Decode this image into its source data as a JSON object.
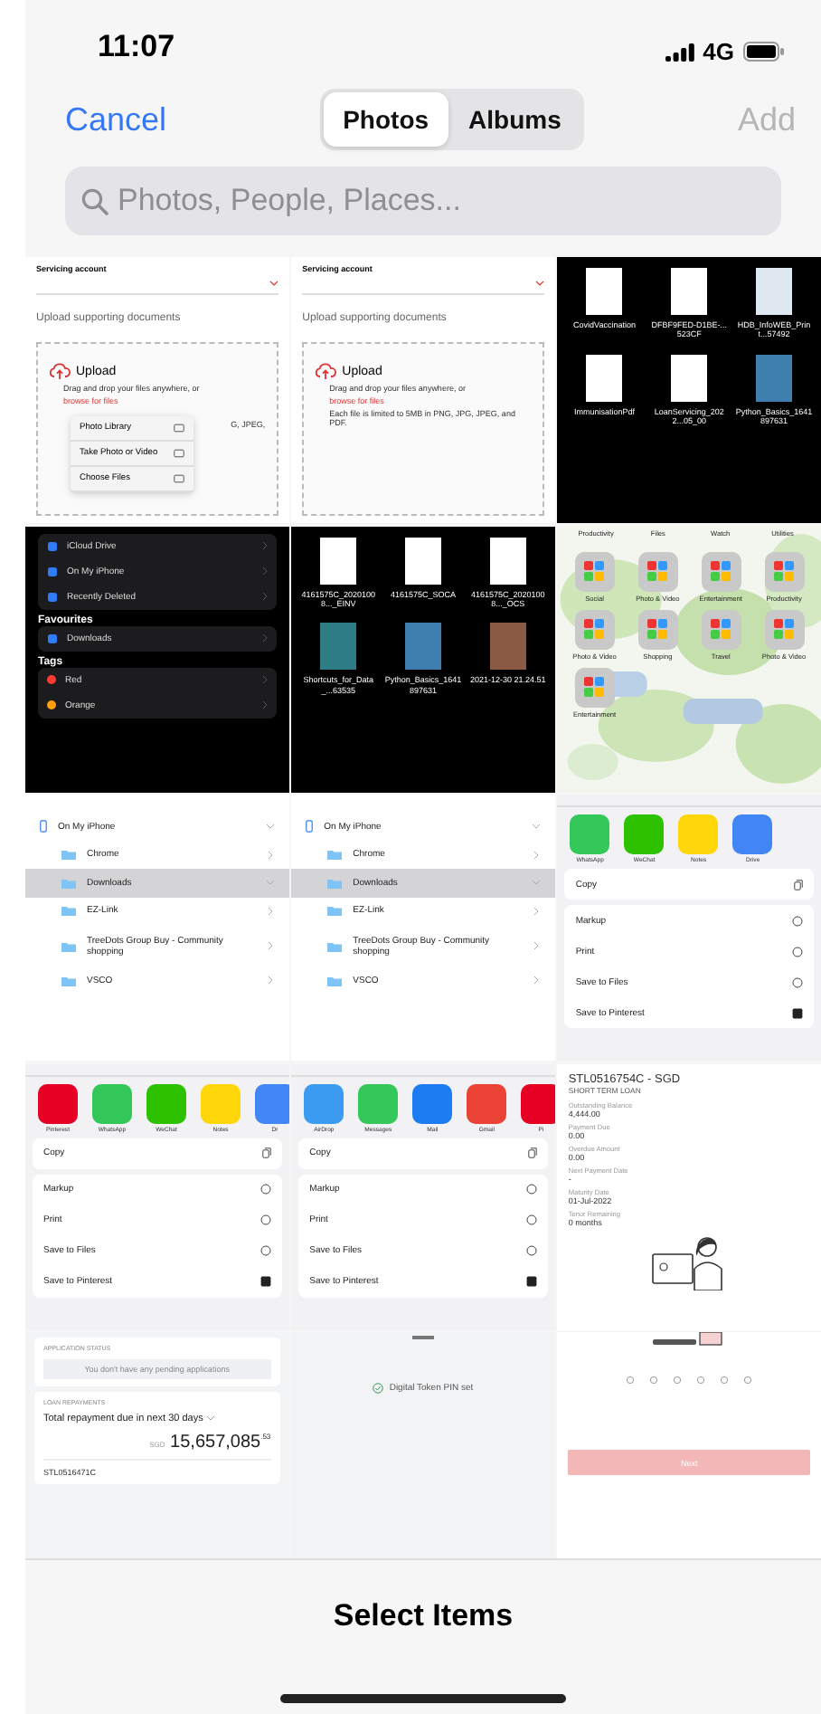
{
  "status_bar": {
    "time": "11:07",
    "network": "4G"
  },
  "nav": {
    "cancel": "Cancel",
    "add": "Add",
    "add_disabled": true,
    "segments": [
      {
        "label": "Photos",
        "selected": true
      },
      {
        "label": "Albums",
        "selected": false
      }
    ]
  },
  "search": {
    "placeholder": "Photos, People, Places..."
  },
  "photos": [
    {
      "kind": "upload_form",
      "field_label": "Servicing account",
      "section": "Upload supporting documents",
      "upload": "Upload",
      "hint": "Drag and drop your files anywhere, or",
      "link": "browse for files",
      "note": "G, JPEG,",
      "menu": [
        "Photo Library",
        "Take Photo or Video",
        "Choose Files"
      ]
    },
    {
      "kind": "upload_form",
      "field_label": "Servicing account",
      "section": "Upload supporting documents",
      "upload": "Upload",
      "hint": "Drag and drop your files anywhere, or",
      "link": "browse for files",
      "note": "Each file is limited to 5MB in PNG, JPG, JPEG, and PDF."
    },
    {
      "kind": "file_grid",
      "files": [
        {
          "name": "CovidVaccination",
          "color": "#ffffff"
        },
        {
          "name": "DFBF9FED-D1BE-...523CF",
          "color": "#ffffff"
        },
        {
          "name": "HDB_InfoWEB_Print...57492",
          "color": "#dfe8f0"
        },
        {
          "name": "ImmunisationPdf",
          "color": "#ffffff"
        },
        {
          "name": "LoanServicing_2022...05_00",
          "color": "#ffffff"
        },
        {
          "name": "Python_Basics_1641897631",
          "color": "#3f7fb0"
        }
      ]
    },
    {
      "kind": "files_sidebar",
      "groups": [
        {
          "items": [
            {
              "label": "iCloud Drive"
            },
            {
              "label": "On My iPhone"
            },
            {
              "label": "Recently Deleted"
            }
          ]
        },
        {
          "title": "Favourites",
          "items": [
            {
              "label": "Downloads"
            }
          ]
        },
        {
          "title": "Tags",
          "items": [
            {
              "label": "Red",
              "color": "#ff3b30"
            },
            {
              "label": "Orange",
              "color": "#ff9f0a"
            }
          ]
        }
      ]
    },
    {
      "kind": "file_grid",
      "files": [
        {
          "name": "4161575C_20201008..._EINV",
          "color": "#ffffff"
        },
        {
          "name": "4161575C_SOCA",
          "color": "#ffffff"
        },
        {
          "name": "4161575C_20201008..._OCS",
          "color": "#ffffff"
        },
        {
          "name": "Shortcuts_for_Data_...63535",
          "color": "#2e7d86"
        },
        {
          "name": "Python_Basics_1641897631",
          "color": "#3f7fb0"
        },
        {
          "name": "2021-12-30 21.24.51",
          "color": "#8a5a44"
        }
      ]
    },
    {
      "kind": "home_screen",
      "top_labels": [
        "Productivity",
        "Files",
        "Watch",
        "Utilities"
      ],
      "folders": [
        {
          "label": "Social"
        },
        {
          "label": "Photo & Video"
        },
        {
          "label": "Entertainment"
        },
        {
          "label": "Productivity"
        },
        {
          "label": "Photo & Video"
        },
        {
          "label": "Shopping"
        },
        {
          "label": "Travel"
        },
        {
          "label": "Photo & Video"
        },
        {
          "label": "Entertainment"
        }
      ]
    },
    {
      "kind": "folder_list",
      "rows": [
        {
          "label": "On My iPhone",
          "selected": false
        },
        {
          "label": "Chrome",
          "selected": false
        },
        {
          "label": "Downloads",
          "selected": true
        },
        {
          "label": "EZ-Link",
          "selected": false
        },
        {
          "label": "TreeDots Group Buy - Community shopping",
          "selected": false
        },
        {
          "label": "VSCO",
          "selected": false
        }
      ]
    },
    {
      "kind": "folder_list",
      "rows": [
        {
          "label": "On My iPhone",
          "selected": false
        },
        {
          "label": "Chrome",
          "selected": false
        },
        {
          "label": "Downloads",
          "selected": true
        },
        {
          "label": "EZ-Link",
          "selected": false
        },
        {
          "label": "TreeDots Group Buy - Community shopping",
          "selected": false
        },
        {
          "label": "VSCO",
          "selected": false
        }
      ]
    },
    {
      "kind": "share_sheet",
      "apps": [
        {
          "label": "WhatsApp",
          "color": "#34c759"
        },
        {
          "label": "WeChat",
          "color": "#2dc100"
        },
        {
          "label": "Notes",
          "color": "#ffd60a"
        },
        {
          "label": "Drive",
          "color": "#4285f4"
        }
      ],
      "actions": [
        "Copy",
        "Markup",
        "Print",
        "Save to Files",
        "Save to Pinterest"
      ]
    },
    {
      "kind": "share_sheet",
      "apps": [
        {
          "label": "Pinterest",
          "color": "#e60023"
        },
        {
          "label": "WhatsApp",
          "color": "#34c759"
        },
        {
          "label": "WeChat",
          "color": "#2dc100"
        },
        {
          "label": "Notes",
          "color": "#ffd60a"
        },
        {
          "label": "Dr",
          "color": "#4285f4"
        }
      ],
      "actions": [
        "Copy",
        "Markup",
        "Print",
        "Save to Files",
        "Save to Pinterest"
      ]
    },
    {
      "kind": "share_sheet",
      "apps": [
        {
          "label": "AirDrop",
          "color": "#3a9bf0"
        },
        {
          "label": "Messages",
          "color": "#34c759"
        },
        {
          "label": "Mail",
          "color": "#1e7cf2"
        },
        {
          "label": "Gmail",
          "color": "#ea4335"
        },
        {
          "label": "Pi",
          "color": "#e60023"
        }
      ],
      "actions": [
        "Copy",
        "Markup",
        "Print",
        "Save to Files",
        "Save to Pinterest"
      ]
    },
    {
      "kind": "loan_detail",
      "title": "STL0516754C - SGD",
      "subtitle": "SHORT TERM LOAN",
      "fields": [
        {
          "label": "Outstanding Balance",
          "value": "4,444.00"
        },
        {
          "label": "Payment Due",
          "value": "0.00"
        },
        {
          "label": "Overdue Amount",
          "value": "0.00"
        },
        {
          "label": "Next Payment Date",
          "value": "-"
        },
        {
          "label": "Maturity Date",
          "value": "01-Jul-2022"
        },
        {
          "label": "Tenor Remaining",
          "value": "0 months"
        }
      ]
    },
    {
      "kind": "dashboard",
      "status_title": "APPLICATION STATUS",
      "status_text": "You don't have any pending applications",
      "repay_title": "LOAN REPAYMENTS",
      "repay_label": "Total repayment due in next 30 days",
      "currency": "SGD",
      "amount": "15,657,085",
      "cents": ".53",
      "loan_id": "STL0516471C"
    },
    {
      "kind": "token",
      "text": "Digital Token PIN set"
    },
    {
      "kind": "loan_next",
      "button": "Next",
      "button_disabled": true
    }
  ],
  "toolbar": {
    "title": "Select Items"
  }
}
